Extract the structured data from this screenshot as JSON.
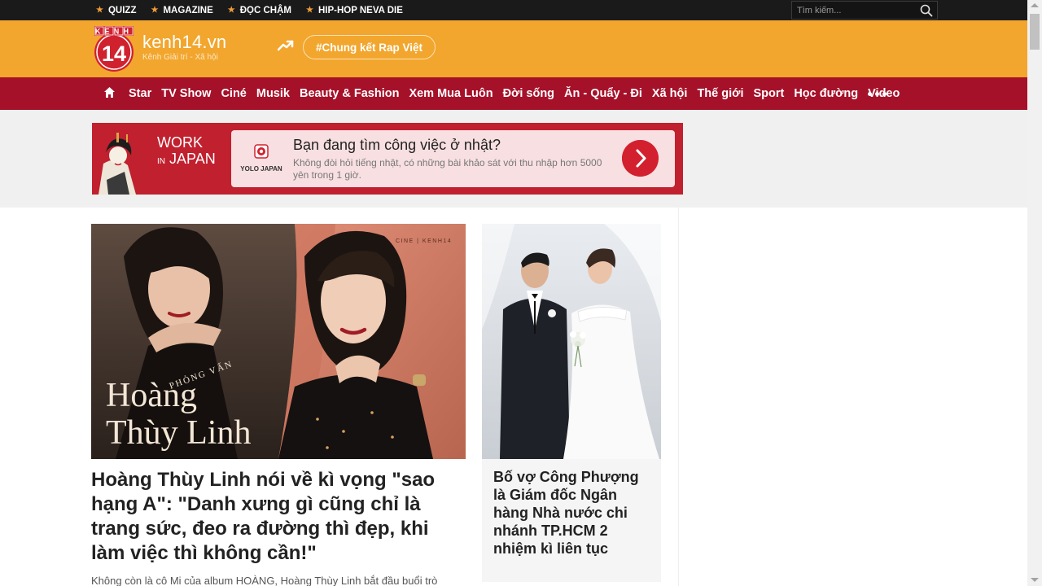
{
  "topbar": {
    "links": [
      "QUIZZ",
      "MAGAZINE",
      "ĐỌC CHẬM",
      "HIP-HOP NEVA DIE"
    ],
    "search_placeholder": "Tìm kiếm...",
    "search_icon": "search-icon"
  },
  "header": {
    "logo_letters": "KENH",
    "logo_number": "14",
    "site_name": "kenh14.vn",
    "tagline": "Kênh Giải trí - Xã hội",
    "trend_icon": "trending-icon",
    "trend_tag": "#Chung kết Rap Việt"
  },
  "nav": {
    "home_icon": "home-icon",
    "items": [
      "Star",
      "TV Show",
      "Ciné",
      "Musik",
      "Beauty & Fashion",
      "Xem Mua Luôn",
      "Đời sống",
      "Ăn - Quẩy - Đi",
      "Xã hội",
      "Thế giới",
      "Sport",
      "Học đường",
      "Video"
    ],
    "more_icon": "more-dots-icon"
  },
  "ad": {
    "work": "WORK",
    "in_japan_prefix": "IN",
    "in_japan": "JAPAN",
    "brand": "YOLO JAPAN",
    "headline": "Bạn đang tìm công việc ở nhật?",
    "description": "Không đòi hỏi tiếng nhật, có những bài khảo sát với thu nhập hơn 5000 yên trong 1 giờ.",
    "cta_icon": "chevron-right-icon",
    "adchoices_icon": "info-icon",
    "close_icon": "close-icon"
  },
  "featured": {
    "image_label": "CINE | KENH14",
    "overlay_kicker": "PHỎNG VẤN",
    "overlay_name_1": "Hoàng",
    "overlay_name_2": "Thùy Linh",
    "title": "Hoàng Thùy Linh nói về kì vọng \"sao hạng A\": \"Danh xưng gì cũng chỉ là trang sức, đeo ra đường thì đẹp, khi làm việc thì không cần!\"",
    "sapo": "Không còn là cô Mi của album HOÀNG, Hoàng Thùy Linh bắt đầu buổi trò"
  },
  "side_story": {
    "title": "Bố vợ Công Phượng là Giám đốc Ngân hàng Nhà nước chi nhánh TP.HCM 2 nhiệm kì liên tục"
  },
  "colors": {
    "topbar": "#1a1a1a",
    "header": "#f2a62d",
    "nav": "#a6112a",
    "accent_star": "#f29d38",
    "ad_red": "#c1202e"
  }
}
